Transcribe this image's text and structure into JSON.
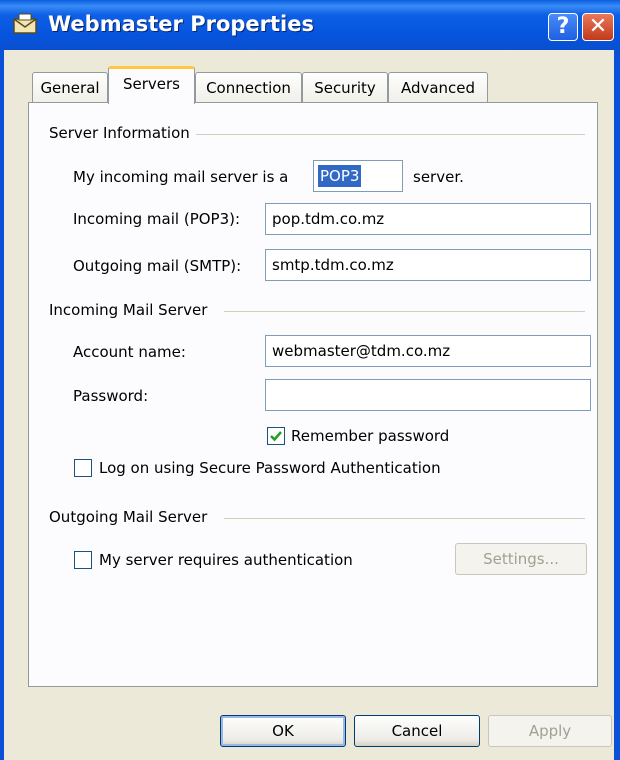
{
  "window": {
    "title": "Webmaster Properties",
    "help_label": "?",
    "close_label": "✕",
    "icon": "mail-properties-icon"
  },
  "tabs": [
    {
      "label": "General",
      "active": false
    },
    {
      "label": "Servers",
      "active": true
    },
    {
      "label": "Connection",
      "active": false
    },
    {
      "label": "Security",
      "active": false
    },
    {
      "label": "Advanced",
      "active": false
    }
  ],
  "server_info": {
    "title": "Server Information",
    "incoming_type_label": "My incoming mail server is a",
    "incoming_type_value": "POP3",
    "incoming_type_suffix": "server.",
    "incoming_label": "Incoming mail (POP3):",
    "incoming_value": "pop.tdm.co.mz",
    "outgoing_label": "Outgoing mail (SMTP):",
    "outgoing_value": "smtp.tdm.co.mz"
  },
  "incoming_server": {
    "title": "Incoming Mail Server",
    "account_label": "Account name:",
    "account_value": "webmaster@tdm.co.mz",
    "password_label": "Password:",
    "password_value": "",
    "remember_label": "Remember password",
    "remember_checked": true,
    "spa_label": "Log on using Secure Password Authentication",
    "spa_checked": false
  },
  "outgoing_server": {
    "title": "Outgoing Mail Server",
    "auth_label": "My server requires authentication",
    "auth_checked": false,
    "settings_label": "Settings..."
  },
  "buttons": {
    "ok": "OK",
    "cancel": "Cancel",
    "apply": "Apply"
  },
  "colors": {
    "title_bar": "#0a5fe0",
    "dialog_bg": "#ece9d8",
    "selection": "#316ac5",
    "active_tab_accent": "#ffc83c"
  }
}
